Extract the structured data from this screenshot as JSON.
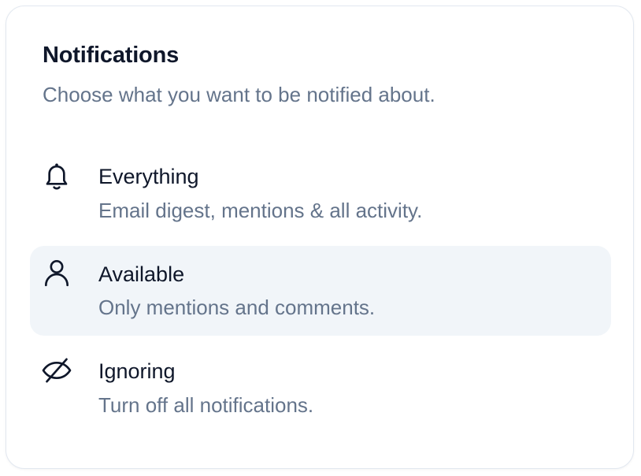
{
  "header": {
    "title": "Notifications",
    "subtitle": "Choose what you want to be notified about."
  },
  "options": [
    {
      "label": "Everything",
      "description": "Email digest, mentions & all activity.",
      "icon": "bell-icon",
      "selected": false
    },
    {
      "label": "Available",
      "description": "Only mentions and comments.",
      "icon": "user-icon",
      "selected": true
    },
    {
      "label": "Ignoring",
      "description": "Turn off all notifications.",
      "icon": "eye-off-icon",
      "selected": false
    }
  ],
  "colors": {
    "text_primary": "#0f172a",
    "text_muted": "#64748b",
    "selected_bg": "#f1f5f9",
    "border": "#e2e8f0"
  }
}
